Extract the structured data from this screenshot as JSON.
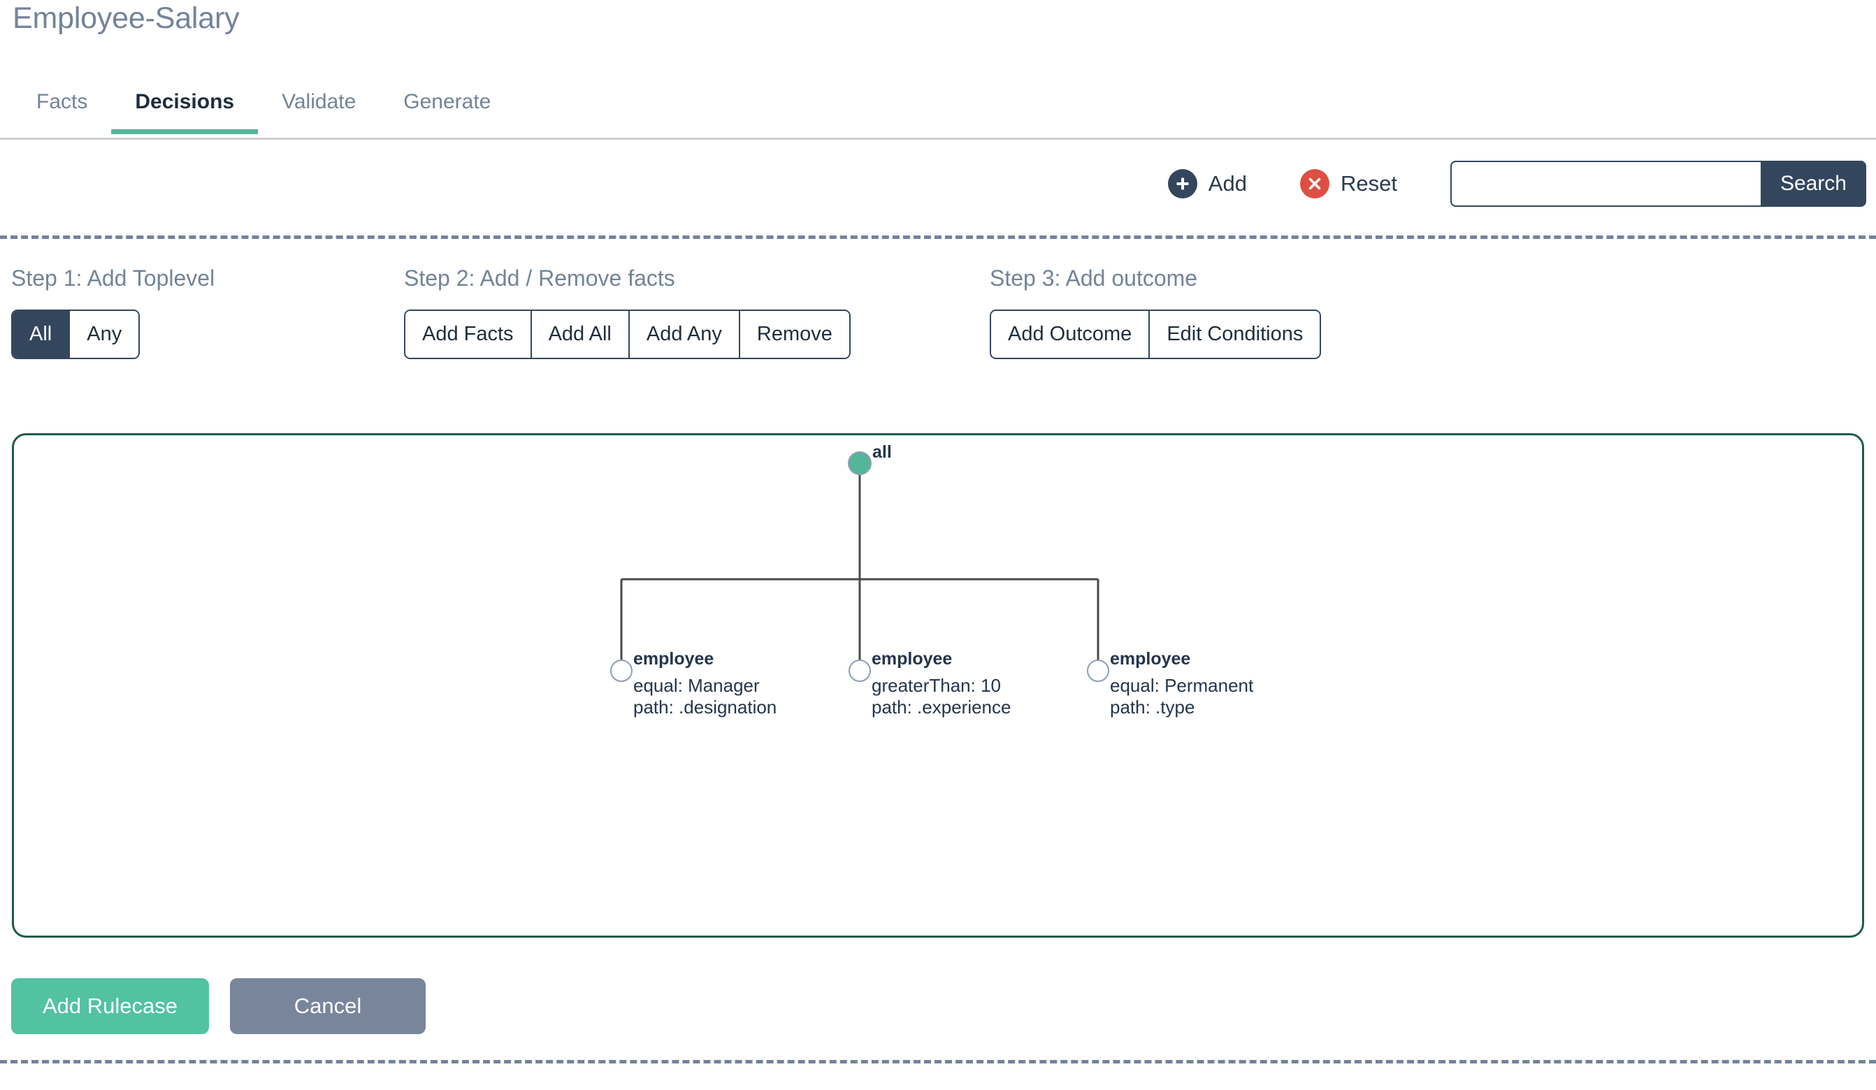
{
  "page": {
    "title": "Employee-Salary"
  },
  "tabs": [
    {
      "label": "Facts",
      "active": false,
      "name": "tab-facts"
    },
    {
      "label": "Decisions",
      "active": true,
      "name": "tab-decisions"
    },
    {
      "label": "Validate",
      "active": false,
      "name": "tab-validate"
    },
    {
      "label": "Generate",
      "active": false,
      "name": "tab-generate"
    }
  ],
  "toolbar": {
    "add_label": "Add",
    "add_icon": "plus-circle-icon",
    "reset_label": "Reset",
    "reset_icon": "x-circle-icon",
    "search_value": "",
    "search_placeholder": "",
    "search_button_label": "Search"
  },
  "steps": [
    {
      "title": "Step 1: Add Toplevel",
      "buttons": [
        {
          "label": "All",
          "selected": true
        },
        {
          "label": "Any",
          "selected": false
        }
      ]
    },
    {
      "title": "Step 2: Add / Remove facts",
      "buttons": [
        {
          "label": "Add Facts",
          "selected": false
        },
        {
          "label": "Add All",
          "selected": false
        },
        {
          "label": "Add Any",
          "selected": false
        },
        {
          "label": "Remove",
          "selected": false
        }
      ]
    },
    {
      "title": "Step 3: Add outcome",
      "buttons": [
        {
          "label": "Add Outcome",
          "selected": false
        },
        {
          "label": "Edit Conditions",
          "selected": false
        }
      ]
    }
  ],
  "tree": {
    "root": {
      "label": "all",
      "filled": true
    },
    "children": [
      {
        "label": "employee",
        "condition": "equal: Manager",
        "path": "path: .designation"
      },
      {
        "label": "employee",
        "condition": "greaterThan: 10",
        "path": "path: .experience"
      },
      {
        "label": "employee",
        "condition": "equal: Permanent",
        "path": "path: .type"
      }
    ]
  },
  "footer": {
    "add_rulecase_label": "Add Rulecase",
    "cancel_label": "Cancel"
  },
  "colors": {
    "accent_green": "#52b699",
    "node_green": "#52b699",
    "navy": "#33465e",
    "red": "#dd4f41",
    "muted": "#73839a",
    "canvas_border": "#1f5b4a"
  }
}
